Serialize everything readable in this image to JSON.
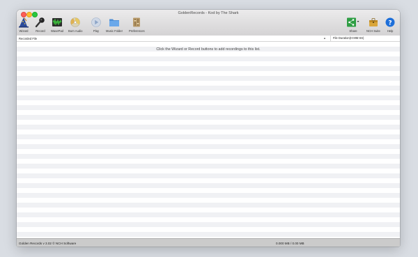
{
  "window": {
    "title": "GoldenRecords - Kod by The Shark"
  },
  "toolbar": {
    "left": [
      {
        "label": "Wizard",
        "icon": "wizard-hat-icon"
      },
      {
        "label": "Record",
        "icon": "microphone-icon"
      },
      {
        "label": "WavePad",
        "icon": "wavepad-icon"
      },
      {
        "label": "Burn Audio",
        "icon": "burn-disc-icon"
      },
      {
        "label": "Play",
        "icon": "play-icon"
      },
      {
        "label": "Music Folder",
        "icon": "folder-icon"
      },
      {
        "label": "Preferences",
        "icon": "preferences-icon"
      }
    ],
    "right": [
      {
        "label": "Share",
        "icon": "share-icon"
      },
      {
        "label": "NCH Suite",
        "icon": "nch-suite-icon"
      },
      {
        "label": "Help",
        "icon": "help-icon"
      }
    ]
  },
  "list": {
    "columns": [
      "Recorded File",
      "File Duration(H:MM:SS)"
    ],
    "empty_message": "Click the Wizard or Record buttons to add recordings to this list."
  },
  "status": {
    "version": "Golden Records v 3.02 © NCH Software",
    "usage": "0.000 MB / 0.00 MB"
  },
  "colors": {
    "desktop": "#d9dde3",
    "row_alt": "#f0f1f4",
    "statusbar": "#cbcbcb",
    "help_blue": "#1e6fd9",
    "share_green": "#2f9e44"
  }
}
